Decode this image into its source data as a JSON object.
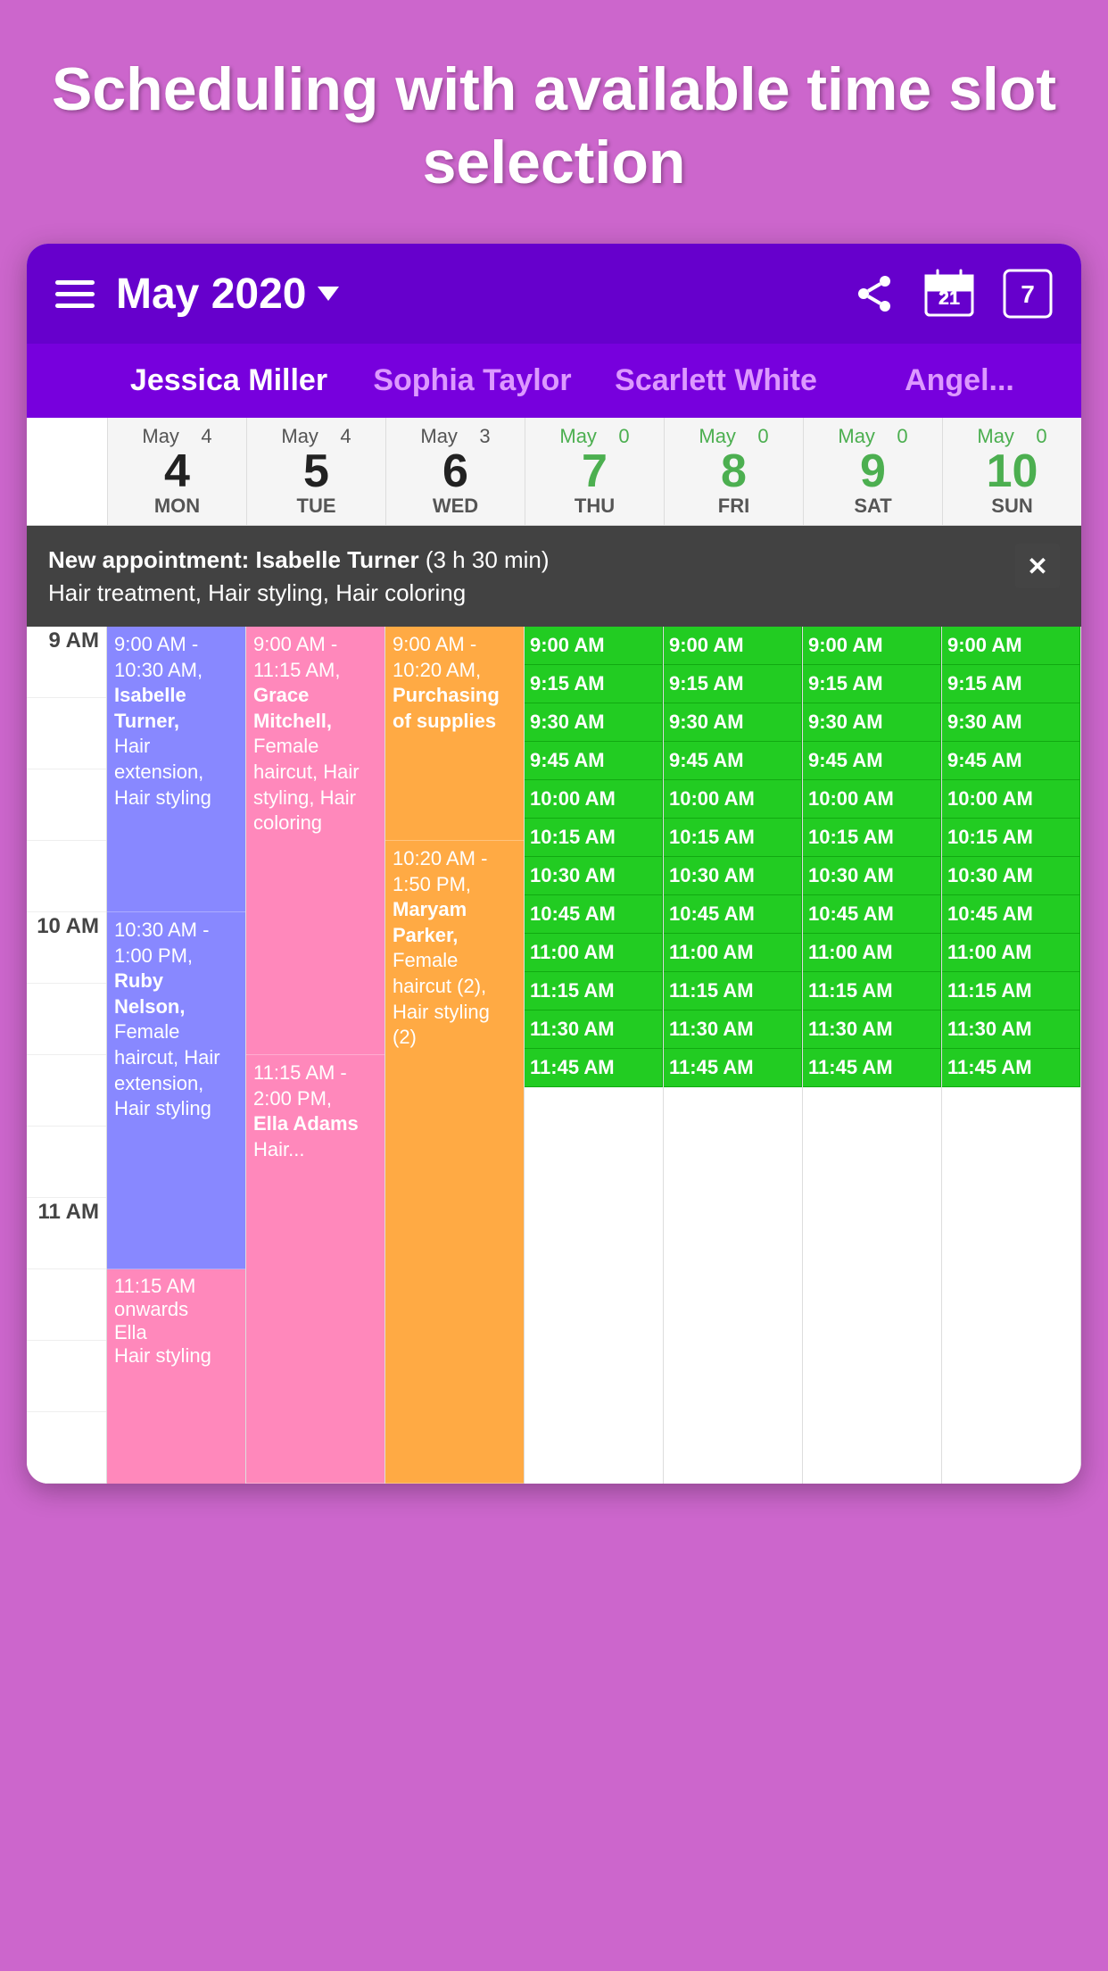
{
  "hero": {
    "title": "Scheduling with available time slot selection"
  },
  "header": {
    "month": "May 2020",
    "share_icon": "share",
    "calendar_icon": "calendar-21",
    "week_icon": "7"
  },
  "staff": [
    {
      "name": "Jessica Miller",
      "active": true
    },
    {
      "name": "Sophia Taylor",
      "active": false
    },
    {
      "name": "Scarlett White",
      "active": false
    },
    {
      "name": "Angel...",
      "active": false
    }
  ],
  "days": [
    {
      "date": 4,
      "day": "MON",
      "appointments": 4,
      "highlight": false
    },
    {
      "date": 5,
      "day": "TUE",
      "appointments": 4,
      "highlight": false
    },
    {
      "date": 6,
      "day": "WED",
      "appointments": 3,
      "highlight": false
    },
    {
      "date": 7,
      "day": "THU",
      "appointments": 0,
      "highlight": true
    },
    {
      "date": 8,
      "day": "FRI",
      "appointments": 0,
      "highlight": true
    },
    {
      "date": 9,
      "day": "SAT",
      "appointments": 0,
      "highlight": true
    },
    {
      "date": 10,
      "day": "SUN",
      "appointments": 0,
      "highlight": true
    }
  ],
  "toast": {
    "title": "New appointment: Isabelle Turner",
    "duration": "(3 h 30 min)",
    "services": "Hair treatment, Hair styling, Hair coloring"
  },
  "appointments": {
    "mon": [
      {
        "time": "9:00 AM - 10:30 AM,",
        "name": "Isabelle Turner,",
        "services": "Hair extension, Hair styling",
        "color": "blue"
      },
      {
        "time": "10:30 AM - 1:00 PM,",
        "name": "Ruby Nelson,",
        "services": "Female haircut, Hair extension, Hair styling",
        "color": "blue"
      }
    ],
    "tue": [
      {
        "time": "9:00 AM - 11:15 AM,",
        "name": "Grace Mitchell,",
        "services": "Female haircut, Hair styling, Hair coloring",
        "color": "pink"
      },
      {
        "time": "11:15 AM - 2:00 PM,",
        "name": "Ella Adams",
        "services": "Hair...",
        "color": "pink"
      }
    ],
    "wed": [
      {
        "time": "9:00 AM - 10:20 AM,",
        "name": "Purchasing of supplies",
        "services": "",
        "color": "orange"
      },
      {
        "time": "10:20 AM - 1:50 PM,",
        "name": "Maryam Parker,",
        "services": "Female haircut (2), Hair styling (2)",
        "color": "orange"
      }
    ]
  },
  "time_labels": [
    "9 AM",
    "",
    "",
    "",
    "",
    "",
    "10 AM",
    "",
    "",
    "",
    "",
    "",
    "11 AM",
    "",
    "",
    "",
    "",
    ""
  ],
  "available_slots": [
    "9:00 AM",
    "9:15 AM",
    "9:30 AM",
    "9:45 AM",
    "10:00 AM",
    "10:15 AM",
    "10:30 AM",
    "10:45 AM",
    "11:00 AM",
    "11:15 AM",
    "11:30 AM",
    "11:45 AM"
  ]
}
